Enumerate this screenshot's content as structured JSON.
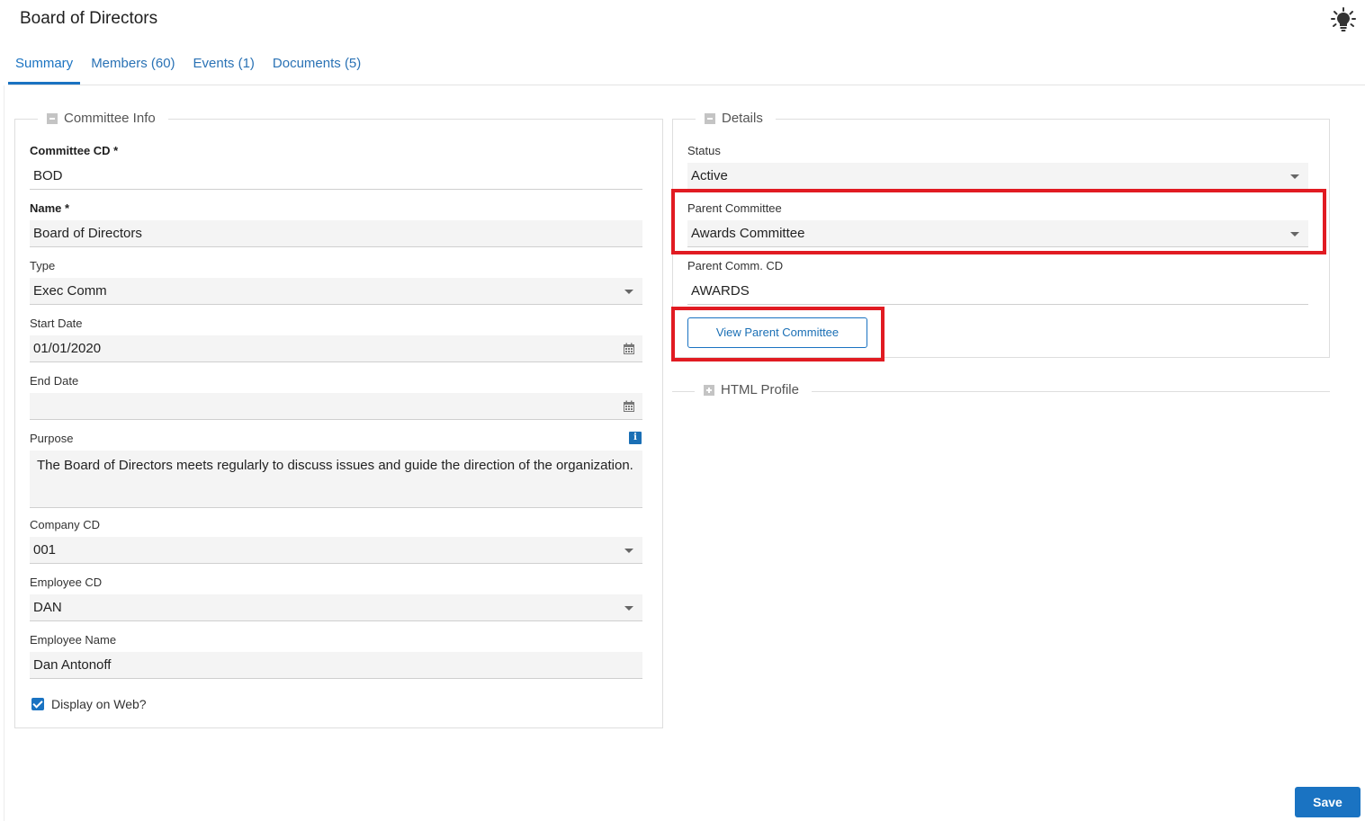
{
  "header": {
    "title": "Board of Directors",
    "help_icon": "lightbulb-icon"
  },
  "tabs": [
    {
      "label": "Summary",
      "active": true
    },
    {
      "label": "Members (60)",
      "active": false
    },
    {
      "label": "Events (1)",
      "active": false
    },
    {
      "label": "Documents (5)",
      "active": false
    }
  ],
  "committee_info": {
    "legend": "Committee Info",
    "committee_cd": {
      "label": "Committee CD *",
      "value": "BOD"
    },
    "name": {
      "label": "Name *",
      "value": "Board of Directors"
    },
    "type": {
      "label": "Type",
      "value": "Exec Comm"
    },
    "start_date": {
      "label": "Start Date",
      "value": "01/01/2020"
    },
    "end_date": {
      "label": "End Date",
      "value": ""
    },
    "purpose": {
      "label": "Purpose",
      "value": "The Board of Directors meets regularly to discuss issues and guide the direction of the organization.",
      "info_icon_glyph": "i"
    },
    "company_cd": {
      "label": "Company CD",
      "value": "001"
    },
    "employee_cd": {
      "label": "Employee CD",
      "value": "DAN"
    },
    "employee_name": {
      "label": "Employee Name",
      "value": "Dan Antonoff"
    },
    "display_on_web": {
      "label": "Display on Web?",
      "checked": true
    }
  },
  "details": {
    "legend": "Details",
    "status": {
      "label": "Status",
      "value": "Active"
    },
    "parent_committee": {
      "label": "Parent Committee",
      "value": "Awards Committee"
    },
    "parent_comm_cd": {
      "label": "Parent Comm. CD",
      "value": "AWARDS"
    },
    "view_parent_button": "View Parent Committee"
  },
  "html_profile": {
    "legend": "HTML Profile"
  },
  "footer": {
    "save_label": "Save"
  },
  "colors": {
    "accent": "#1a73c2",
    "highlight": "#e11b22",
    "field_bg": "#f4f4f4"
  }
}
